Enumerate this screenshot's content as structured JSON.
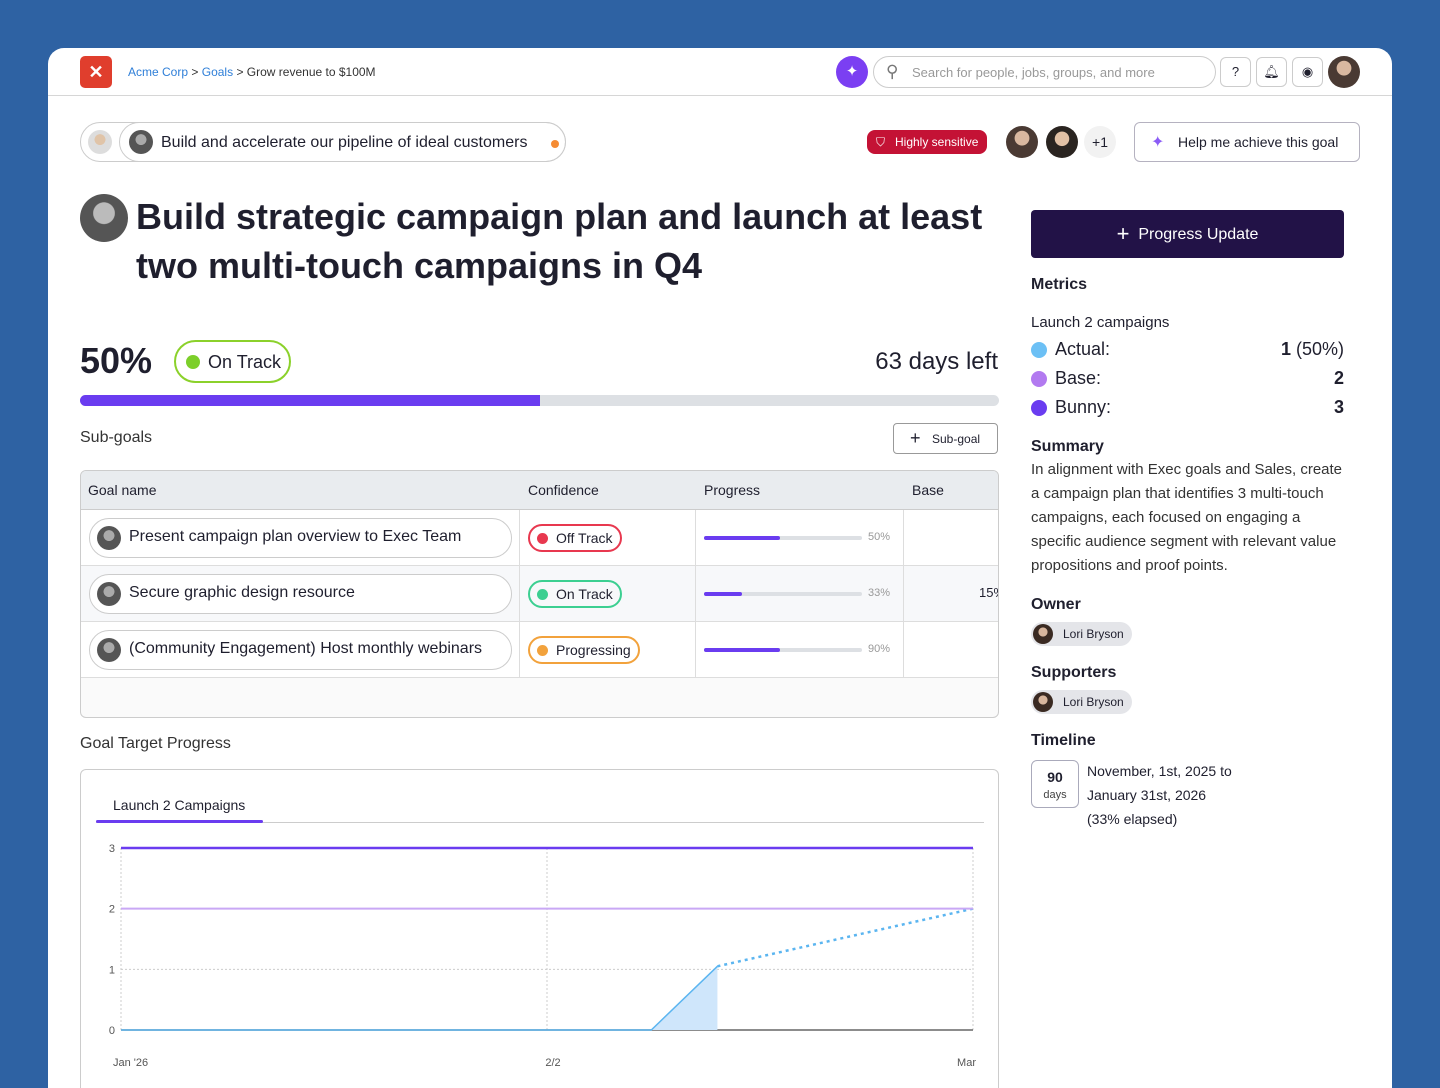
{
  "header": {
    "breadcrumb": [
      "Acme Corp",
      "Goals",
      "Grow revenue to $100M"
    ],
    "sep": ">",
    "search_placeholder": "Search for people, jobs, groups, and more",
    "help": "?"
  },
  "parent_goal": "Build and accelerate our pipeline of ideal customers",
  "sensitivity": "Highly sensitive",
  "more_people": "+1",
  "help_button": "Help me achieve this goal",
  "title": "Build strategic campaign plan and launch at least two multi-touch campaigns in Q4",
  "progress": {
    "percent_label": "50%",
    "percent": 50,
    "status": "On Track",
    "days_left": "63 days left"
  },
  "subgoals": {
    "label": "Sub-goals",
    "add_label": "Sub-goal",
    "columns": [
      "Goal name",
      "Confidence",
      "Progress",
      "Base"
    ],
    "rows": [
      {
        "name": "Present campaign plan overview to Exec Team",
        "confidence": "Off Track",
        "color": "#e8384f",
        "progress": "50%",
        "fill": 48,
        "base": ""
      },
      {
        "name": "Secure graphic design resource",
        "confidence": "On Track",
        "color": "#3ccf91",
        "progress": "33%",
        "fill": 24,
        "base": "15%"
      },
      {
        "name": "(Community Engagement) Host monthly webinars",
        "confidence": "Progressing",
        "color": "#f2a23c",
        "progress": "90%",
        "fill": 48,
        "base": ""
      }
    ]
  },
  "goal_target_label": "Goal Target Progress",
  "chart_data": {
    "type": "line",
    "tab": "Launch 2 Campaigns",
    "ylim": [
      0,
      3
    ],
    "yticks": [
      "0",
      "1",
      "2",
      "3"
    ],
    "xlim": [
      0,
      58
    ],
    "xticks": [
      {
        "label": "Jan '26",
        "x": 0
      },
      {
        "label": "2/2",
        "x": 29
      },
      {
        "label": "Mar",
        "x": 58
      }
    ],
    "series": [
      {
        "name": "Actual",
        "color": "#5bb5f0",
        "points": [
          [
            0,
            0
          ],
          [
            29,
            0
          ],
          [
            36.1,
            0
          ],
          [
            40.6,
            1.05
          ]
        ]
      },
      {
        "name": "Projection",
        "color": "#5bb5f0",
        "dashed": true,
        "points": [
          [
            40.6,
            1.05
          ],
          [
            58,
            2
          ]
        ]
      },
      {
        "name": "Base",
        "color": "#c9a8f5",
        "points": [
          [
            0,
            2
          ],
          [
            58,
            2
          ]
        ]
      },
      {
        "name": "Bunny",
        "color": "#6a3cf0",
        "points": [
          [
            0,
            3
          ],
          [
            58,
            3
          ]
        ]
      }
    ]
  },
  "sidebar": {
    "progress_update": "Progress Update",
    "metrics_label": "Metrics",
    "metric_name": "Launch 2 campaigns",
    "metrics": [
      {
        "label": "Actual:",
        "value": "1",
        "extra": " (50%)",
        "color": "#6cc0f5"
      },
      {
        "label": "Base:",
        "value": "2",
        "extra": "",
        "color": "#b27af0"
      },
      {
        "label": "Bunny:",
        "value": "3",
        "extra": "",
        "color": "#6a3cf0"
      }
    ],
    "summary_label": "Summary",
    "summary": "In alignment with Exec goals and Sales, create a campaign plan that identifies 3 multi-touch campaigns, each focused on engaging a specific audience segment with relevant value propositions and proof points.",
    "owner_label": "Owner",
    "owner": "Lori Bryson",
    "supporters_label": "Supporters",
    "supporter": "Lori Bryson",
    "timeline_label": "Timeline",
    "timeline_days": "90",
    "timeline_unit": "days",
    "timeline_range": "November, 1st, 2025 to",
    "timeline_end": "January 31st, 2026",
    "timeline_elapsed": "(33% elapsed)"
  }
}
